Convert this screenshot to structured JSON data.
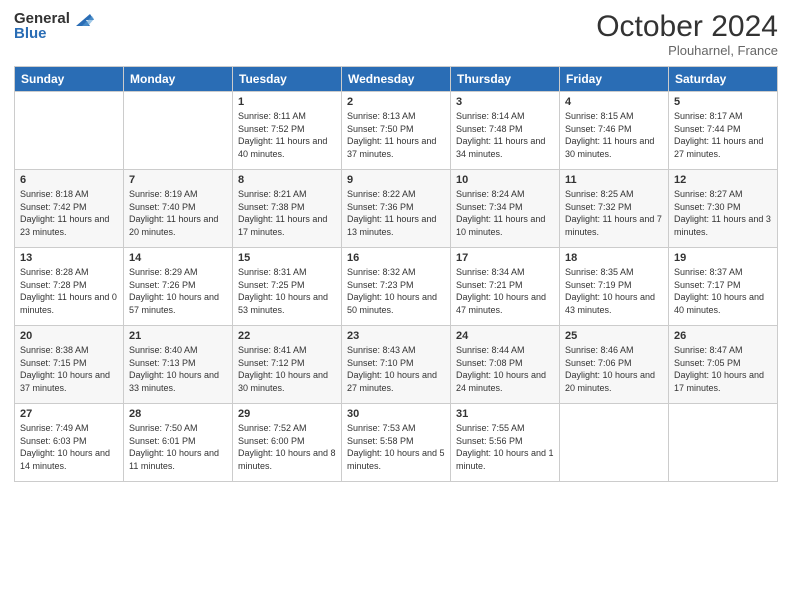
{
  "header": {
    "logo_general": "General",
    "logo_blue": "Blue",
    "month_title": "October 2024",
    "location": "Plouharnel, France"
  },
  "weekdays": [
    "Sunday",
    "Monday",
    "Tuesday",
    "Wednesday",
    "Thursday",
    "Friday",
    "Saturday"
  ],
  "weeks": [
    [
      null,
      null,
      {
        "day": "1",
        "sunrise": "Sunrise: 8:11 AM",
        "sunset": "Sunset: 7:52 PM",
        "daylight": "Daylight: 11 hours and 40 minutes."
      },
      {
        "day": "2",
        "sunrise": "Sunrise: 8:13 AM",
        "sunset": "Sunset: 7:50 PM",
        "daylight": "Daylight: 11 hours and 37 minutes."
      },
      {
        "day": "3",
        "sunrise": "Sunrise: 8:14 AM",
        "sunset": "Sunset: 7:48 PM",
        "daylight": "Daylight: 11 hours and 34 minutes."
      },
      {
        "day": "4",
        "sunrise": "Sunrise: 8:15 AM",
        "sunset": "Sunset: 7:46 PM",
        "daylight": "Daylight: 11 hours and 30 minutes."
      },
      {
        "day": "5",
        "sunrise": "Sunrise: 8:17 AM",
        "sunset": "Sunset: 7:44 PM",
        "daylight": "Daylight: 11 hours and 27 minutes."
      }
    ],
    [
      {
        "day": "6",
        "sunrise": "Sunrise: 8:18 AM",
        "sunset": "Sunset: 7:42 PM",
        "daylight": "Daylight: 11 hours and 23 minutes."
      },
      {
        "day": "7",
        "sunrise": "Sunrise: 8:19 AM",
        "sunset": "Sunset: 7:40 PM",
        "daylight": "Daylight: 11 hours and 20 minutes."
      },
      {
        "day": "8",
        "sunrise": "Sunrise: 8:21 AM",
        "sunset": "Sunset: 7:38 PM",
        "daylight": "Daylight: 11 hours and 17 minutes."
      },
      {
        "day": "9",
        "sunrise": "Sunrise: 8:22 AM",
        "sunset": "Sunset: 7:36 PM",
        "daylight": "Daylight: 11 hours and 13 minutes."
      },
      {
        "day": "10",
        "sunrise": "Sunrise: 8:24 AM",
        "sunset": "Sunset: 7:34 PM",
        "daylight": "Daylight: 11 hours and 10 minutes."
      },
      {
        "day": "11",
        "sunrise": "Sunrise: 8:25 AM",
        "sunset": "Sunset: 7:32 PM",
        "daylight": "Daylight: 11 hours and 7 minutes."
      },
      {
        "day": "12",
        "sunrise": "Sunrise: 8:27 AM",
        "sunset": "Sunset: 7:30 PM",
        "daylight": "Daylight: 11 hours and 3 minutes."
      }
    ],
    [
      {
        "day": "13",
        "sunrise": "Sunrise: 8:28 AM",
        "sunset": "Sunset: 7:28 PM",
        "daylight": "Daylight: 11 hours and 0 minutes."
      },
      {
        "day": "14",
        "sunrise": "Sunrise: 8:29 AM",
        "sunset": "Sunset: 7:26 PM",
        "daylight": "Daylight: 10 hours and 57 minutes."
      },
      {
        "day": "15",
        "sunrise": "Sunrise: 8:31 AM",
        "sunset": "Sunset: 7:25 PM",
        "daylight": "Daylight: 10 hours and 53 minutes."
      },
      {
        "day": "16",
        "sunrise": "Sunrise: 8:32 AM",
        "sunset": "Sunset: 7:23 PM",
        "daylight": "Daylight: 10 hours and 50 minutes."
      },
      {
        "day": "17",
        "sunrise": "Sunrise: 8:34 AM",
        "sunset": "Sunset: 7:21 PM",
        "daylight": "Daylight: 10 hours and 47 minutes."
      },
      {
        "day": "18",
        "sunrise": "Sunrise: 8:35 AM",
        "sunset": "Sunset: 7:19 PM",
        "daylight": "Daylight: 10 hours and 43 minutes."
      },
      {
        "day": "19",
        "sunrise": "Sunrise: 8:37 AM",
        "sunset": "Sunset: 7:17 PM",
        "daylight": "Daylight: 10 hours and 40 minutes."
      }
    ],
    [
      {
        "day": "20",
        "sunrise": "Sunrise: 8:38 AM",
        "sunset": "Sunset: 7:15 PM",
        "daylight": "Daylight: 10 hours and 37 minutes."
      },
      {
        "day": "21",
        "sunrise": "Sunrise: 8:40 AM",
        "sunset": "Sunset: 7:13 PM",
        "daylight": "Daylight: 10 hours and 33 minutes."
      },
      {
        "day": "22",
        "sunrise": "Sunrise: 8:41 AM",
        "sunset": "Sunset: 7:12 PM",
        "daylight": "Daylight: 10 hours and 30 minutes."
      },
      {
        "day": "23",
        "sunrise": "Sunrise: 8:43 AM",
        "sunset": "Sunset: 7:10 PM",
        "daylight": "Daylight: 10 hours and 27 minutes."
      },
      {
        "day": "24",
        "sunrise": "Sunrise: 8:44 AM",
        "sunset": "Sunset: 7:08 PM",
        "daylight": "Daylight: 10 hours and 24 minutes."
      },
      {
        "day": "25",
        "sunrise": "Sunrise: 8:46 AM",
        "sunset": "Sunset: 7:06 PM",
        "daylight": "Daylight: 10 hours and 20 minutes."
      },
      {
        "day": "26",
        "sunrise": "Sunrise: 8:47 AM",
        "sunset": "Sunset: 7:05 PM",
        "daylight": "Daylight: 10 hours and 17 minutes."
      }
    ],
    [
      {
        "day": "27",
        "sunrise": "Sunrise: 7:49 AM",
        "sunset": "Sunset: 6:03 PM",
        "daylight": "Daylight: 10 hours and 14 minutes."
      },
      {
        "day": "28",
        "sunrise": "Sunrise: 7:50 AM",
        "sunset": "Sunset: 6:01 PM",
        "daylight": "Daylight: 10 hours and 11 minutes."
      },
      {
        "day": "29",
        "sunrise": "Sunrise: 7:52 AM",
        "sunset": "Sunset: 6:00 PM",
        "daylight": "Daylight: 10 hours and 8 minutes."
      },
      {
        "day": "30",
        "sunrise": "Sunrise: 7:53 AM",
        "sunset": "Sunset: 5:58 PM",
        "daylight": "Daylight: 10 hours and 5 minutes."
      },
      {
        "day": "31",
        "sunrise": "Sunrise: 7:55 AM",
        "sunset": "Sunset: 5:56 PM",
        "daylight": "Daylight: 10 hours and 1 minute."
      },
      null,
      null
    ]
  ]
}
